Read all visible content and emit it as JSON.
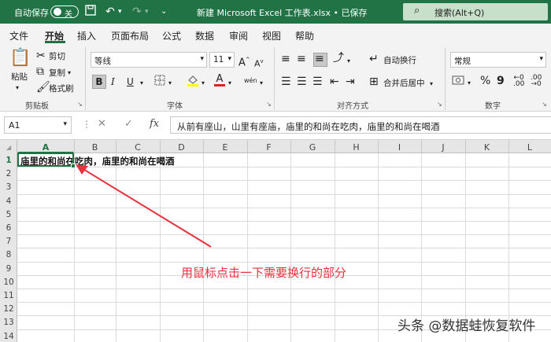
{
  "titlebar": {
    "autosave_label": "自动保存",
    "toggle_label": "关",
    "doc_title": "新建 Microsoft Excel 工作表.xlsx • 已保存",
    "search_placeholder": "搜索(Alt+Q)",
    "icons": [
      "save-icon",
      "undo-icon",
      "redo-icon",
      "customize-icon",
      "search-icon"
    ]
  },
  "menu": {
    "tabs": [
      "文件",
      "开始",
      "插入",
      "页面布局",
      "公式",
      "数据",
      "审阅",
      "视图",
      "帮助"
    ],
    "active_tab": "开始"
  },
  "ribbon": {
    "clipboard": {
      "paste": "粘贴",
      "cut": "剪切",
      "copy": "复制",
      "format_painter": "格式刷",
      "group_label": "剪贴板"
    },
    "font": {
      "font_name": "等线",
      "font_size": "11",
      "grow": "A",
      "shrink": "A",
      "bold": "B",
      "italic": "I",
      "underline": "U",
      "font_color": "A",
      "phonetic": "wén",
      "group_label": "字体"
    },
    "alignment": {
      "wrap_text": "自动换行",
      "merge_center": "合并后居中",
      "group_label": "对齐方式"
    },
    "number": {
      "format": "常规",
      "percent": "%",
      "comma": "9",
      "group_label": "数字"
    }
  },
  "formula_bar": {
    "name_box": "A1",
    "fx": "fx",
    "formula": "从前有座山，山里有座庙，庙里的和尚在吃肉，庙里的和尚在喝酒"
  },
  "sheet": {
    "columns": [
      "A",
      "B",
      "C",
      "D",
      "E",
      "F",
      "G",
      "H",
      "I",
      "J",
      "K",
      "L"
    ],
    "rows": [
      "1",
      "2",
      "3",
      "4",
      "5",
      "6",
      "7",
      "8",
      "9",
      "10",
      "11",
      "12",
      "13",
      "14"
    ],
    "selected_cell": "A1",
    "cell_a1_display": "庙里的和尚在吃肉，庙里的和尚在喝酒"
  },
  "annotation": "用鼠标点击一下需要换行的部分",
  "watermark": "头条 @数据蛙恢复软件",
  "colors": {
    "accent": "#217346",
    "annotation": "#e8323c",
    "search_bg": "#c6e0c9"
  }
}
